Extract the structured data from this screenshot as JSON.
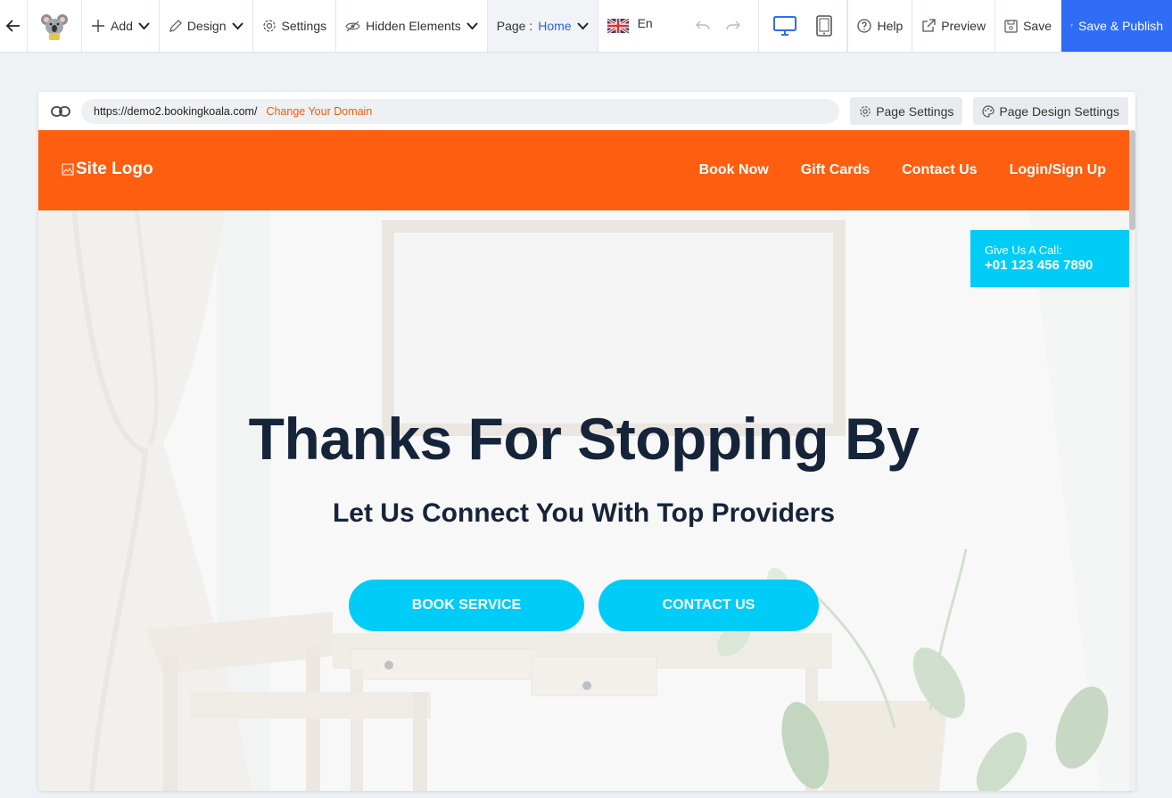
{
  "toolbar": {
    "add_label": "Add",
    "design_label": "Design",
    "settings_label": "Settings",
    "hidden_label": "Hidden Elements",
    "page_prefix": "Page :",
    "page_value": "Home",
    "lang_label": "En",
    "help_label": "Help",
    "preview_label": "Preview",
    "save_label": "Save",
    "publish_label": "Save & Publish"
  },
  "frame": {
    "url": "https://demo2.bookingkoala.com/",
    "change_domain": "Change Your Domain",
    "page_settings": "Page Settings",
    "page_design_settings": "Page Design Settings"
  },
  "site": {
    "logo_alt": "Site Logo",
    "nav": [
      "Book Now",
      "Gift Cards",
      "Contact Us",
      "Login/Sign Up"
    ],
    "call_label": "Give Us A Call:",
    "call_number": "+01 123 456 7890",
    "hero_title": "Thanks For Stopping By",
    "hero_subtitle": "Let Us Connect You With Top Providers",
    "btn_book": "BOOK SERVICE",
    "btn_contact": "CONTACT US"
  },
  "colors": {
    "header_orange": "#fd5e0f",
    "accent_cyan": "#00cdf7",
    "publish_blue": "#2f6df6",
    "title_navy": "#16243a",
    "link_orange": "#f25c05"
  },
  "icons": [
    "back-arrow-icon",
    "koala-logo-icon",
    "plus-icon",
    "pencil-icon",
    "gear-icon",
    "eye-slash-icon",
    "chevron-down-icon",
    "uk-flag-icon",
    "undo-icon",
    "redo-icon",
    "desktop-icon",
    "tablet-icon",
    "help-icon",
    "external-link-icon",
    "save-icon",
    "upload-icon",
    "link-icon",
    "palette-icon",
    "broken-image-icon"
  ]
}
